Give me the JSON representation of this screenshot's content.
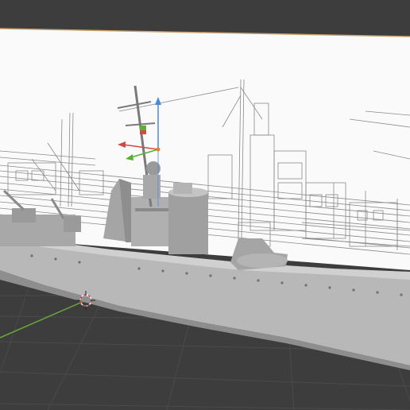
{
  "viewport": {
    "background_color": "#3d3d3d",
    "grid_line_color": "#4a4a4a",
    "x_axis_color": "#b24a4a",
    "y_axis_color": "#6aa33a"
  },
  "reference_image": {
    "background_color": "#fafafa",
    "line_color": "#8a8a8a"
  },
  "model": {
    "fill_color": "#b8b8b8",
    "shade_color": "#8e8e8e",
    "highlight_color": "#d0d0d0"
  },
  "gizmo": {
    "x_axis_color": "#d04848",
    "y_axis_color": "#58b030",
    "z_axis_color": "#4a8ad8",
    "pivot_color": "#e08030"
  },
  "icons": [
    "3d-cursor-icon",
    "transform-gizmo-icon",
    "origin-point-icon"
  ]
}
